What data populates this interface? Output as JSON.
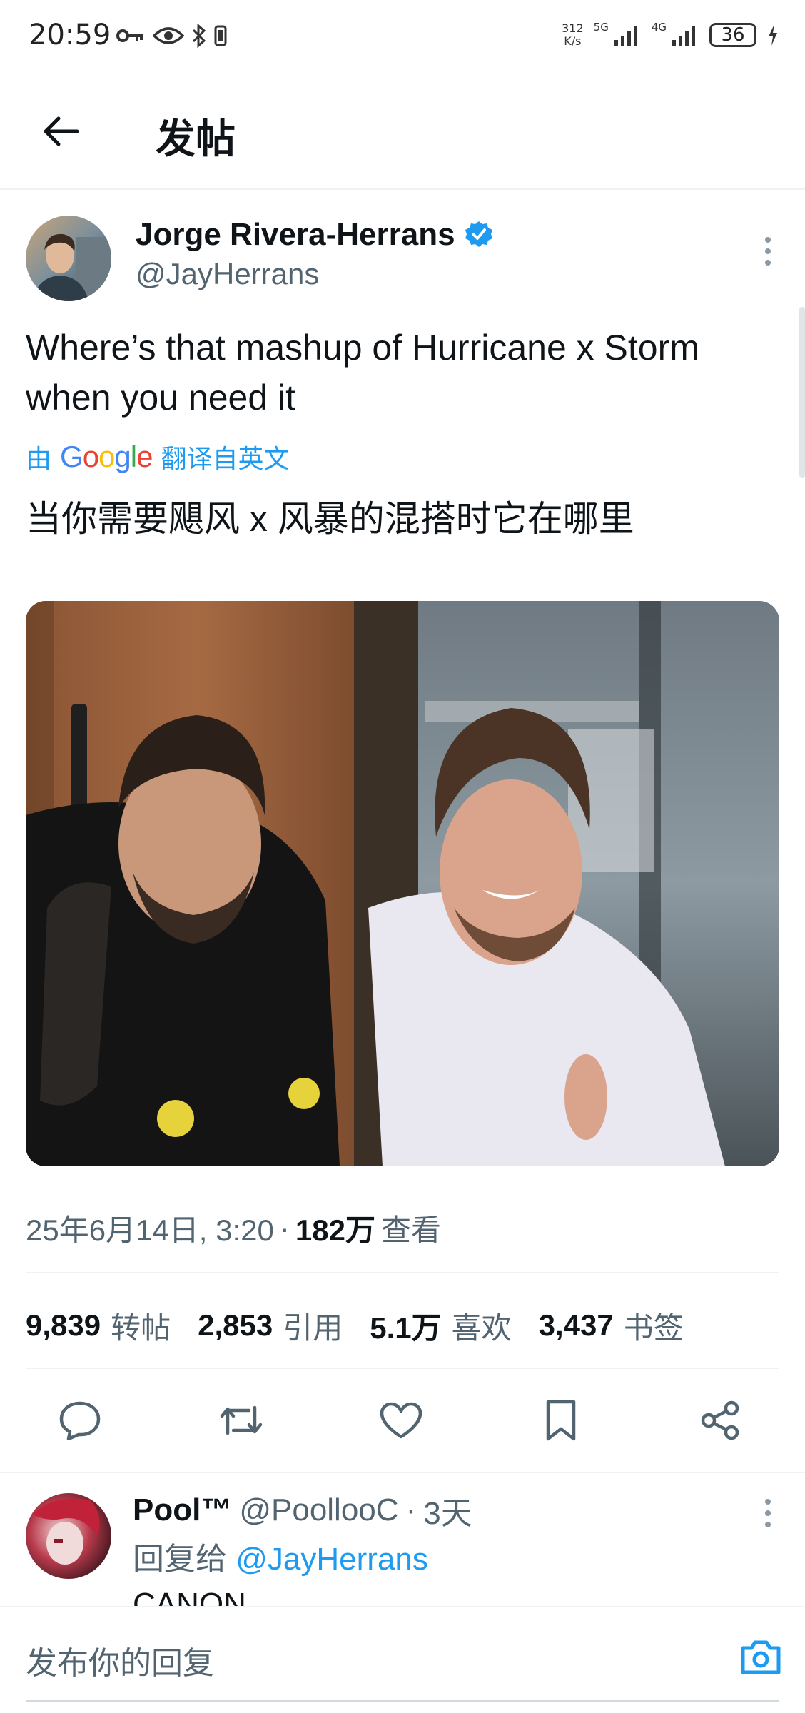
{
  "status_bar": {
    "time": "20:59",
    "network_speed_value": "312",
    "network_speed_unit": "K/s",
    "net1": "5G",
    "net2": "4G",
    "battery": "36",
    "icons": [
      "key-icon",
      "eye-icon",
      "bluetooth-icon",
      "vibrate-icon",
      "signal-icon",
      "signal-icon",
      "battery-icon",
      "charging-icon"
    ]
  },
  "header": {
    "title": "发帖"
  },
  "tweet": {
    "author_name": "Jorge Rivera-Herrans",
    "handle": "@JayHerrans",
    "verified": true,
    "text": "Where’s that mashup of Hurricane x Storm when you need it",
    "translate_prefix": "由",
    "translate_brand": "Google",
    "translate_suffix": "翻译自英文",
    "translated_text": "当你需要飓风 x 风暴的混搭时它在哪里",
    "timestamp": "25年6月14日, 3:20",
    "separator": "·",
    "views_count": "182万",
    "views_label": "查看"
  },
  "stats": [
    {
      "num": "9,839",
      "label": "转帖"
    },
    {
      "num": "2,853",
      "label": "引用"
    },
    {
      "num": "5.1万",
      "label": "喜欢"
    },
    {
      "num": "3,437",
      "label": "书签"
    }
  ],
  "actions": [
    "reply-icon",
    "retweet-icon",
    "like-icon",
    "bookmark-icon",
    "share-icon"
  ],
  "reply": {
    "name": "Pool™",
    "handle": "@PoollooC",
    "separator": "·",
    "time": "3天",
    "reply_to_label": "回复给",
    "reply_to_handle": "@JayHerrans",
    "text": "CANON"
  },
  "compose": {
    "placeholder": "发布你的回复"
  },
  "colors": {
    "accent": "#1d9bf0",
    "text": "#0f1419",
    "muted": "#536471",
    "divider": "#eff3f4"
  }
}
